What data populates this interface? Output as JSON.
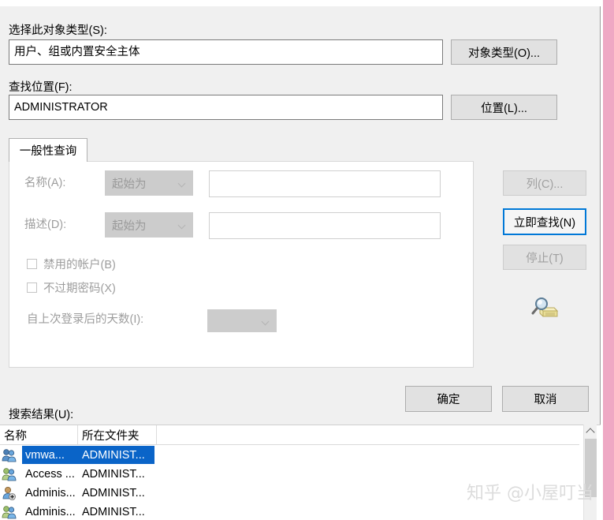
{
  "dialog": {
    "object_type_label": "选择此对象类型(S):",
    "object_type_value": "用户、组或内置安全主体",
    "object_type_button": "对象类型(O)...",
    "location_label": "查找位置(F):",
    "location_value": "ADMINISTRATOR",
    "location_button": "位置(L)...",
    "ok_button": "确定",
    "cancel_button": "取消"
  },
  "tab": {
    "label": "一般性查询",
    "name_label": "名称(A):",
    "name_condition": "起始为",
    "name_value": "",
    "desc_label": "描述(D):",
    "desc_condition": "起始为",
    "desc_value": "",
    "disabled_accounts": "禁用的帐户(B)",
    "non_expiring_password": "不过期密码(X)",
    "days_since_logon_label": "自上次登录后的天数(I):",
    "days_since_logon_value": ""
  },
  "side_buttons": {
    "columns": "列(C)...",
    "find_now": "立即查找(N)",
    "stop": "停止(T)",
    "search_icon": "magnifier-folder-icon"
  },
  "results": {
    "label": "搜索结果(U):",
    "columns": [
      "名称",
      "所在文件夹"
    ],
    "rows": [
      {
        "icon": "group-icon",
        "name": "vmwa...",
        "folder": "ADMINIST...",
        "selected": true
      },
      {
        "icon": "group-icon",
        "name": "Access ...",
        "folder": "ADMINIST...",
        "selected": false
      },
      {
        "icon": "user-add-icon",
        "name": "Adminis...",
        "folder": "ADMINIST...",
        "selected": false
      },
      {
        "icon": "group-icon",
        "name": "Adminis...",
        "folder": "ADMINIST...",
        "selected": false
      }
    ]
  },
  "scrollbar": {
    "up_arrow": "chevron-up-icon"
  },
  "watermark": "知乎 @小屋叮当",
  "colors": {
    "accent": "#0078d7",
    "selection": "#0a64c8",
    "dialog_bg": "#f0f0f0",
    "page_pink": "#efa8c4"
  }
}
